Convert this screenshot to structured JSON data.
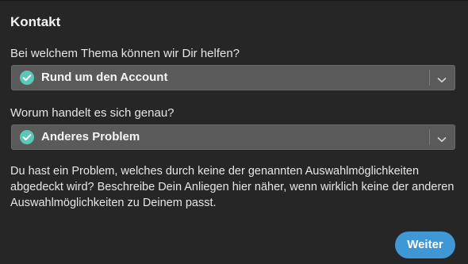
{
  "header": {
    "title": "Kontakt"
  },
  "topic": {
    "question": "Bei welchem Thema können wir Dir helfen?",
    "selected": "Rund um den Account"
  },
  "detail": {
    "question": "Worum handelt es sich genau?",
    "selected": "Anderes Problem"
  },
  "description": "Du hast ein Problem, welches durch keine der genannten Auswahlmöglichkeiten abgedeckt wird? Beschreibe Dein Anliegen hier näher, wenn wirklich keine der anderen Auswahlmöglichkeiten zu Deinem passt.",
  "actions": {
    "next_label": "Weiter"
  },
  "icons": {
    "selected_indicator": "check-circle-icon",
    "dropdown_arrow": "chevron-down-icon"
  },
  "colors": {
    "panel_bg": "#262626",
    "select_bg": "#5a5a5a",
    "check": "#5bc7b4",
    "accent": "#3f97d3"
  }
}
